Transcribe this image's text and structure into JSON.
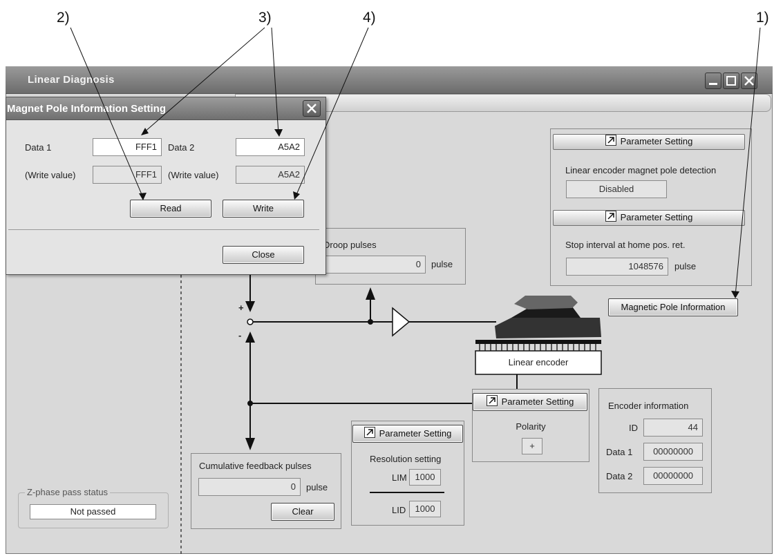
{
  "callouts": [
    "2)",
    "3)",
    "4)",
    "1)"
  ],
  "window": {
    "title": "Linear Diagnosis"
  },
  "dialog": {
    "title": "Magnet Pole Information Setting",
    "data1_label": "Data 1",
    "data1_value": "FFF1",
    "data2_label": "Data 2",
    "data2_value": "A5A2",
    "write_value_label_1": "(Write value)",
    "write_value_1": "FFF1",
    "write_value_label_2": "(Write value)",
    "write_value_2": "A5A2",
    "read_button": "Read",
    "write_button": "Write",
    "close_button": "Close"
  },
  "magnet_pole_detection": {
    "param_button": "Parameter Setting",
    "label": "Linear encoder magnet pole detection",
    "value": "Disabled"
  },
  "stop_interval": {
    "param_button": "Parameter Setting",
    "label": "Stop interval at home pos. ret.",
    "value": "1048576",
    "unit": "pulse"
  },
  "magnetic_pole_info_button": "Magnetic Pole Information",
  "droop": {
    "label": "Droop pulses",
    "value": "0",
    "unit": "pulse"
  },
  "diagram": {
    "plus": "+",
    "minus": "-",
    "encoder_label": "Linear encoder"
  },
  "polarity": {
    "param_button": "Parameter Setting",
    "label": "Polarity",
    "value": "+"
  },
  "encoder_info": {
    "title": "Encoder information",
    "id_label": "ID",
    "id_value": "44",
    "data1_label": "Data 1",
    "data1_value": "00000000",
    "data2_label": "Data 2",
    "data2_value": "00000000"
  },
  "resolution": {
    "param_button": "Parameter Setting",
    "label": "Resolution setting",
    "lim_label": "LIM",
    "lim_value": "1000",
    "lid_label": "LID",
    "lid_value": "1000"
  },
  "cumulative": {
    "label": "Cumulative feedback pulses",
    "value": "0",
    "unit": "pulse",
    "clear_button": "Clear"
  },
  "zphase": {
    "label": "Z-phase pass status",
    "value": "Not passed"
  }
}
